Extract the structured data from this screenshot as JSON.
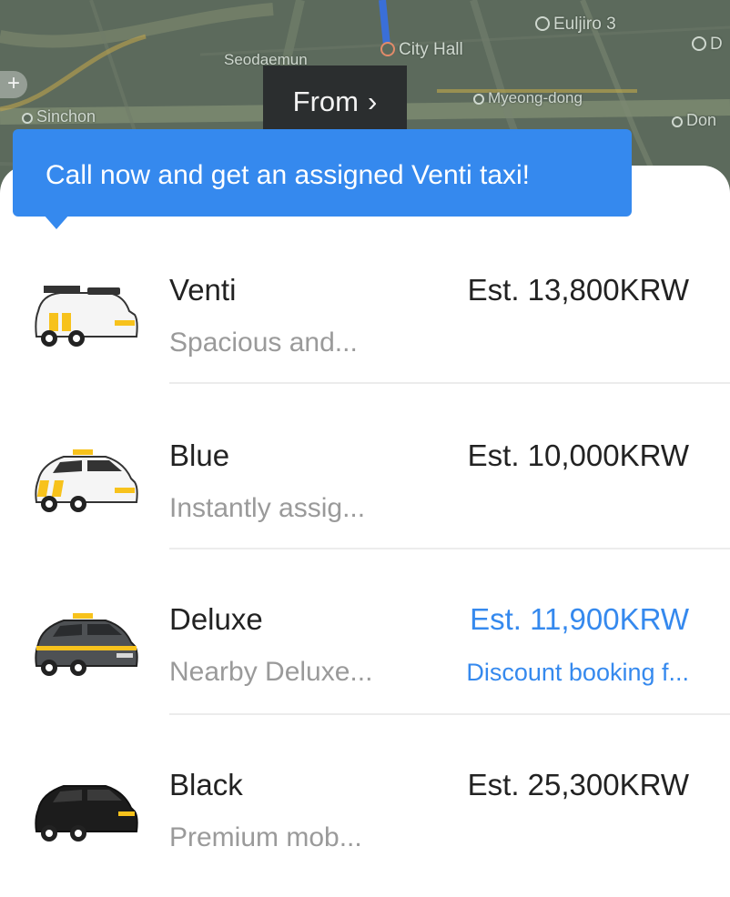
{
  "map": {
    "labels": {
      "euljiro": "Euljiro 3",
      "city_hall": "City Hall",
      "seodaemun": "Seodaemun",
      "myeongdong": "Myeong-dong",
      "sinchon": "Sinchon",
      "dong": "Don",
      "edge": "D"
    },
    "from_label": "From",
    "from_chevron": "›",
    "zoom_label": "+"
  },
  "banner": {
    "text": "Call now and get an assigned Venti taxi!"
  },
  "rides": [
    {
      "name": "Venti",
      "description": "Spacious and...",
      "price": "Est. 13,800KRW",
      "note": "",
      "icon": "venti-taxi-icon",
      "highlight": false
    },
    {
      "name": "Blue",
      "description": "Instantly assig...",
      "price": "Est. 10,000KRW",
      "note": "",
      "icon": "blue-taxi-icon",
      "highlight": false
    },
    {
      "name": "Deluxe",
      "description": "Nearby Deluxe...",
      "price": "Est. 11,900KRW",
      "note": "Discount booking f...",
      "icon": "deluxe-taxi-icon",
      "highlight": true
    },
    {
      "name": "Black",
      "description": "Premium mob...",
      "price": "Est. 25,300KRW",
      "note": "",
      "icon": "black-car-icon",
      "highlight": false
    }
  ],
  "colors": {
    "accent": "#3589ee",
    "taxi_yellow": "#f7c21c",
    "deluxe_gray": "#4e5154",
    "black_car": "#1c1c1c"
  }
}
